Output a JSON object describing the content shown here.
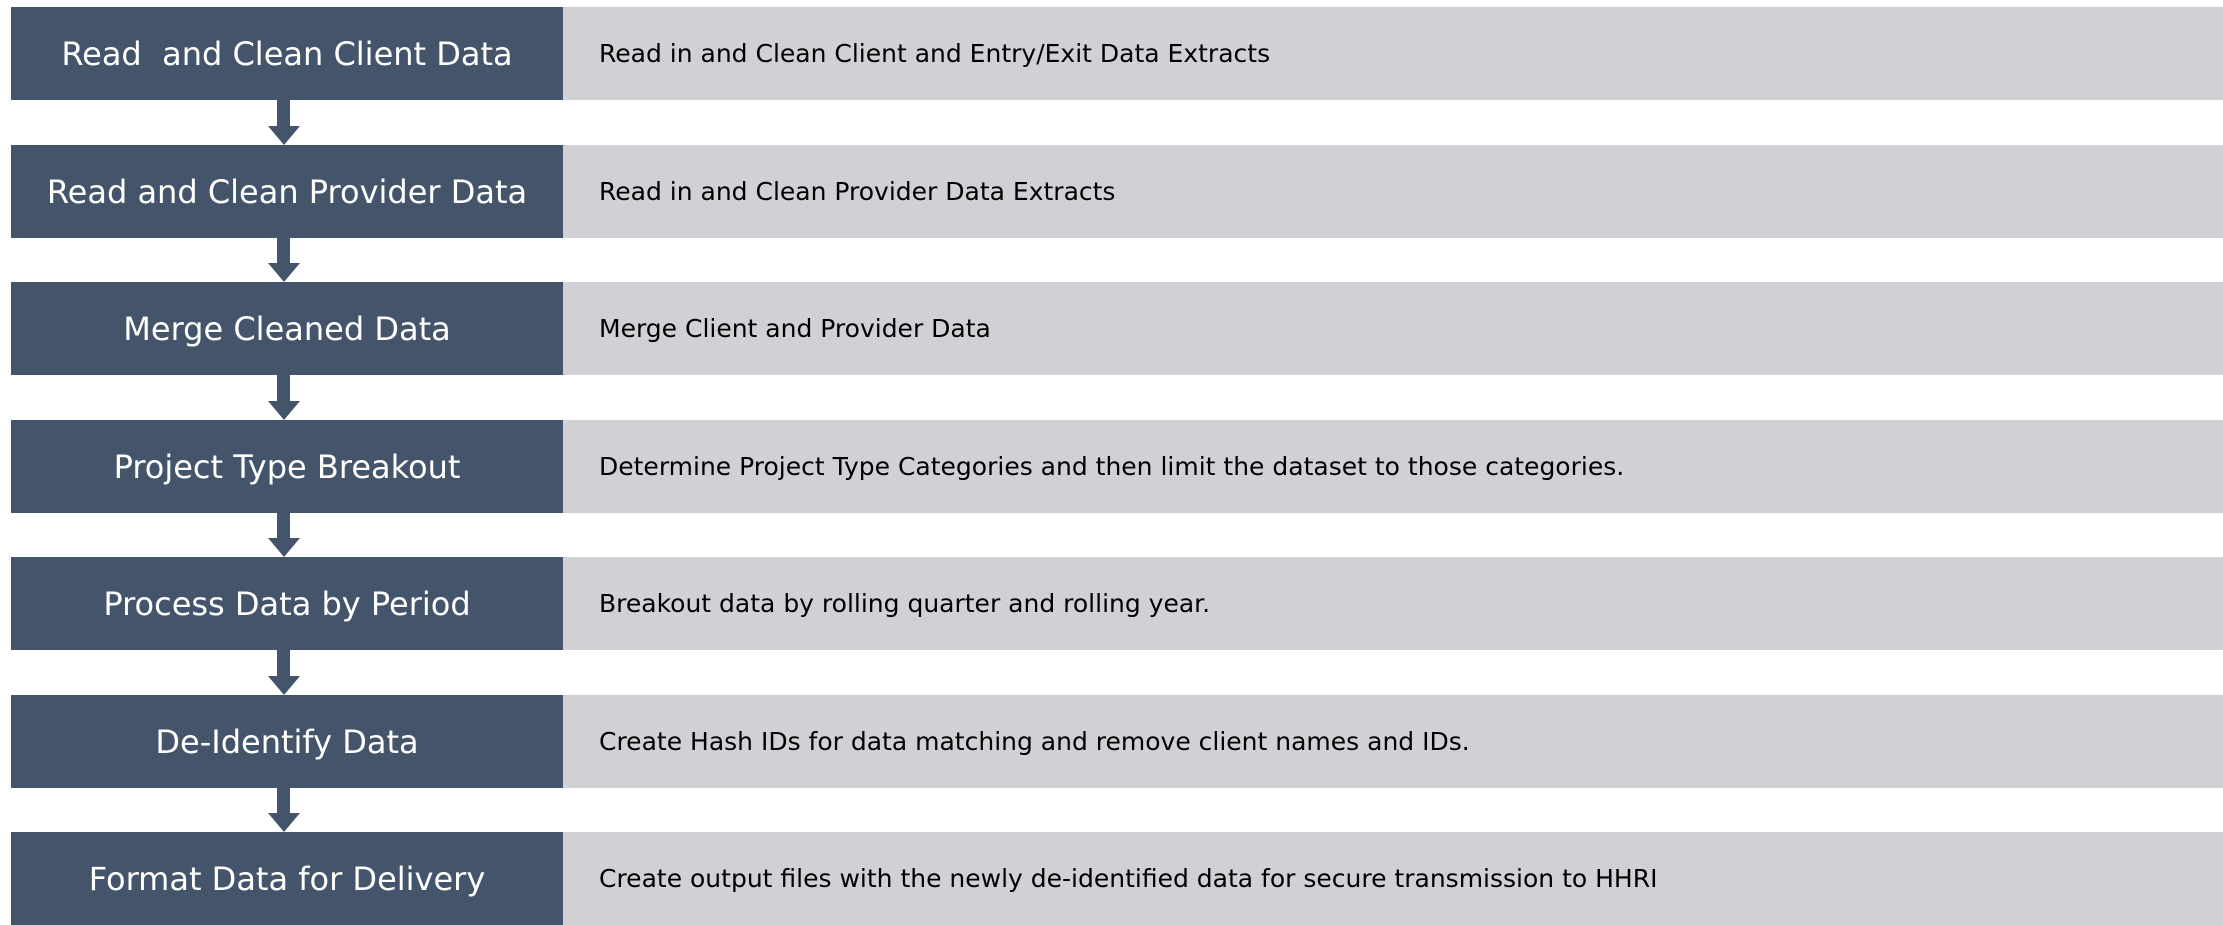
{
  "colors": {
    "title_box": "#44546a",
    "description_box": "#d0d1d5",
    "connector": "#44546a",
    "title_text": "#ffffff",
    "description_text": "#000000"
  },
  "steps": [
    {
      "title": "Read  and Clean Client Data",
      "description": "Read in and Clean Client and Entry/Exit Data Extracts"
    },
    {
      "title": "Read and Clean Provider Data",
      "description": "Read in and Clean Provider Data Extracts"
    },
    {
      "title": "Merge Cleaned Data",
      "description": "Merge Client and Provider Data"
    },
    {
      "title": "Project Type Breakout",
      "description": "Determine Project Type Categories and then limit the dataset to those categories."
    },
    {
      "title": "Process Data by Period",
      "description": "Breakout data by rolling quarter and rolling year."
    },
    {
      "title": "De-Identify Data",
      "description": "Create Hash IDs for data matching and remove client names and IDs."
    },
    {
      "title": "Format Data for Delivery",
      "description": "Create output files with the newly de-identified data for secure transmission to HHRI"
    }
  ]
}
